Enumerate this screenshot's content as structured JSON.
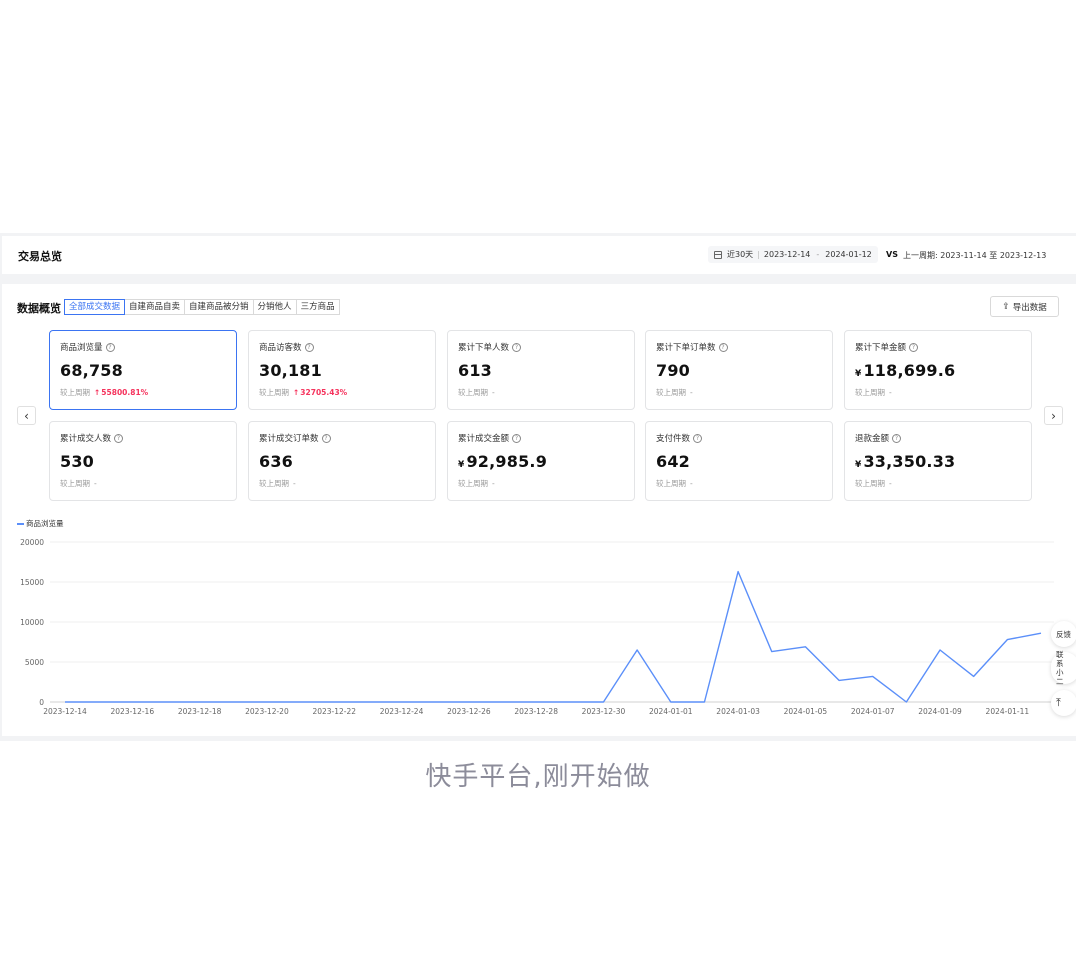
{
  "header": {
    "title": "交易总览",
    "range_label": "近30天",
    "start_date": "2023-12-14",
    "date_separator": "-",
    "end_date": "2024-01-12",
    "vs": "VS",
    "prev_period": "上一周期: 2023-11-14 至 2023-12-13"
  },
  "overview": {
    "title": "数据概览",
    "tabs": [
      "全部成交数据",
      "自建商品自卖",
      "自建商品被分销",
      "分销他人",
      "三方商品"
    ],
    "active_tab": 0,
    "export_label": "导出数据"
  },
  "metrics": [
    {
      "label": "商品浏览量",
      "currency": "",
      "value": "68,758",
      "compare_label": "较上周期",
      "compare_value": "55800.81%",
      "trend": "up",
      "selected": true
    },
    {
      "label": "商品访客数",
      "currency": "",
      "value": "30,181",
      "compare_label": "较上周期",
      "compare_value": "32705.43%",
      "trend": "up",
      "selected": false
    },
    {
      "label": "累计下单人数",
      "currency": "",
      "value": "613",
      "compare_label": "较上周期",
      "compare_value": "-",
      "trend": "none",
      "selected": false
    },
    {
      "label": "累计下单订单数",
      "currency": "",
      "value": "790",
      "compare_label": "较上周期",
      "compare_value": "-",
      "trend": "none",
      "selected": false
    },
    {
      "label": "累计下单金额",
      "currency": "¥",
      "value": "118,699.6",
      "compare_label": "较上周期",
      "compare_value": "-",
      "trend": "none",
      "selected": false
    },
    {
      "label": "累计成交人数",
      "currency": "",
      "value": "530",
      "compare_label": "较上周期",
      "compare_value": "-",
      "trend": "none",
      "selected": false
    },
    {
      "label": "累计成交订单数",
      "currency": "",
      "value": "636",
      "compare_label": "较上周期",
      "compare_value": "-",
      "trend": "none",
      "selected": false
    },
    {
      "label": "累计成交金额",
      "currency": "¥",
      "value": "92,985.9",
      "compare_label": "较上周期",
      "compare_value": "-",
      "trend": "none",
      "selected": false
    },
    {
      "label": "支付件数",
      "currency": "",
      "value": "642",
      "compare_label": "较上周期",
      "compare_value": "-",
      "trend": "none",
      "selected": false
    },
    {
      "label": "退款金额",
      "currency": "¥",
      "value": "33,350.33",
      "compare_label": "较上周期",
      "compare_value": "-",
      "trend": "none",
      "selected": false
    }
  ],
  "side_buttons": {
    "feedback": "反馈",
    "contact": "联系小二"
  },
  "caption": "快手平台,刚开始做",
  "colors": {
    "accent": "#3b74f2",
    "line": "#5b8ff9",
    "up": "#f5325c"
  },
  "chart_data": {
    "type": "line",
    "title": "",
    "xlabel": "",
    "ylabel": "",
    "ylim": [
      0,
      20000
    ],
    "yticks": [
      0,
      5000,
      10000,
      15000,
      20000
    ],
    "x_tick_labels": [
      "2023-12-14",
      "2023-12-16",
      "2023-12-18",
      "2023-12-20",
      "2023-12-22",
      "2023-12-24",
      "2023-12-26",
      "2023-12-28",
      "2023-12-30",
      "2024-01-01",
      "2024-01-03",
      "2024-01-05",
      "2024-01-07",
      "2024-01-09",
      "2024-01-11"
    ],
    "x": [
      "2023-12-14",
      "2023-12-15",
      "2023-12-16",
      "2023-12-17",
      "2023-12-18",
      "2023-12-19",
      "2023-12-20",
      "2023-12-21",
      "2023-12-22",
      "2023-12-23",
      "2023-12-24",
      "2023-12-25",
      "2023-12-26",
      "2023-12-27",
      "2023-12-28",
      "2023-12-29",
      "2023-12-30",
      "2023-12-31",
      "2024-01-01",
      "2024-01-02",
      "2024-01-03",
      "2024-01-04",
      "2024-01-05",
      "2024-01-06",
      "2024-01-07",
      "2024-01-08",
      "2024-01-09",
      "2024-01-10",
      "2024-01-11",
      "2024-01-12"
    ],
    "series": [
      {
        "name": "商品浏览量",
        "values": [
          0,
          0,
          0,
          0,
          0,
          0,
          0,
          0,
          0,
          0,
          0,
          0,
          0,
          0,
          0,
          0,
          0,
          6500,
          0,
          0,
          16300,
          6300,
          6900,
          2700,
          3200,
          0,
          6500,
          3200,
          7800,
          8600
        ]
      }
    ],
    "legend_position": "top-left",
    "grid": true
  }
}
